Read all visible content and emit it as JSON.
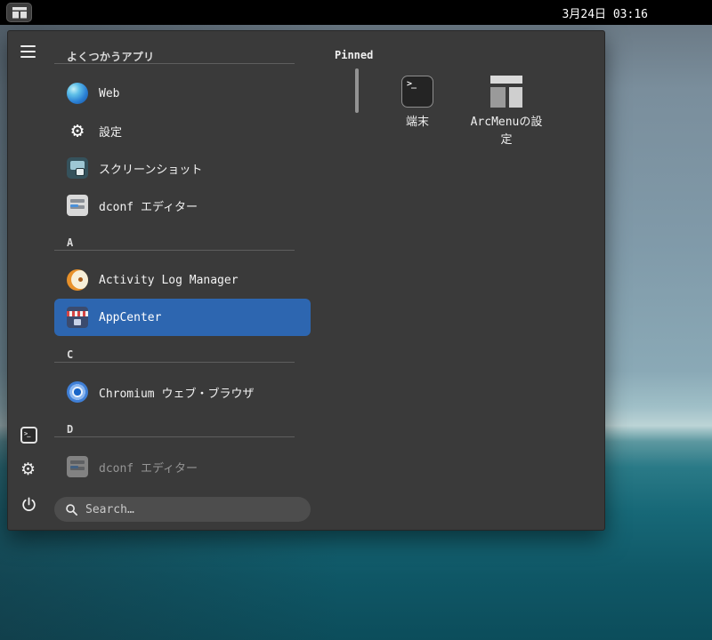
{
  "panel": {
    "clock": "3月24日 03:16",
    "menu_button_icon": "arcmenu-icon"
  },
  "menu": {
    "rail": {
      "top_icon": "hamburger-menu-icon",
      "bottom_icons": [
        "terminal-icon",
        "settings-gear-icon",
        "power-icon"
      ]
    },
    "frequent": {
      "header": "よくつかうアプリ",
      "items": [
        {
          "label": "Web",
          "icon": "web-browser-icon"
        },
        {
          "label": "設定",
          "icon": "settings-gear-icon"
        },
        {
          "label": "スクリーンショット",
          "icon": "screenshot-icon"
        },
        {
          "label": "dconf エディター",
          "icon": "dconf-editor-icon"
        }
      ]
    },
    "sections": [
      {
        "letter": "A",
        "items": [
          {
            "label": "Activity Log Manager",
            "icon": "activity-log-icon",
            "state": "normal"
          },
          {
            "label": "AppCenter",
            "icon": "appcenter-icon",
            "state": "selected"
          }
        ]
      },
      {
        "letter": "C",
        "items": [
          {
            "label": "Chromium ウェブ・ブラウザ",
            "icon": "chromium-icon",
            "state": "normal"
          }
        ]
      },
      {
        "letter": "D",
        "items": [
          {
            "label": "dconf エディター",
            "icon": "dconf-editor-icon",
            "state": "dimmed"
          }
        ]
      }
    ],
    "search": {
      "placeholder": "Search…",
      "icon": "search-icon"
    },
    "pinned": {
      "header": "Pinned",
      "items": [
        {
          "label": "端末",
          "icon": "terminal-icon"
        },
        {
          "label": "ArcMenuの設定",
          "icon": "arcmenu-settings-icon"
        }
      ]
    }
  },
  "colors": {
    "accent_selected": "#2d66b0",
    "menu_background": "#3a3a3a",
    "panel_background": "#000000"
  }
}
